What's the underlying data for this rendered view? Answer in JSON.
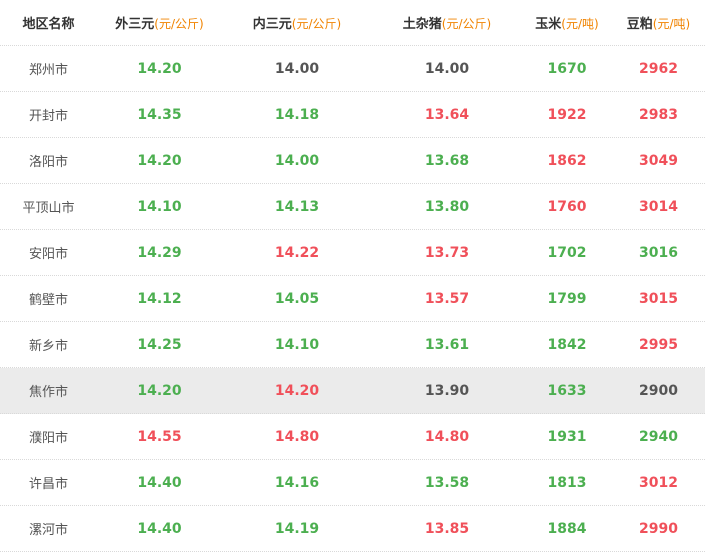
{
  "header": {
    "region": "地区名称",
    "cols": [
      {
        "name": "外三元",
        "unit": "(元/公斤)"
      },
      {
        "name": "内三元",
        "unit": "(元/公斤)"
      },
      {
        "name": "土杂猪",
        "unit": "(元/公斤)"
      },
      {
        "name": "玉米",
        "unit": "(元/吨)"
      },
      {
        "name": "豆粕",
        "unit": "(元/吨)"
      }
    ]
  },
  "colors": {
    "green": "#4caf50",
    "red": "#f0505a",
    "gray": "#555555",
    "unit_orange": "#f08300",
    "highlight_bg": "#ebebeb"
  },
  "rows": [
    {
      "region": "郑州市",
      "highlight": false,
      "values": [
        {
          "v": "14.20",
          "c": "green"
        },
        {
          "v": "14.00",
          "c": "gray"
        },
        {
          "v": "14.00",
          "c": "gray"
        },
        {
          "v": "1670",
          "c": "green"
        },
        {
          "v": "2962",
          "c": "red"
        }
      ]
    },
    {
      "region": "开封市",
      "highlight": false,
      "values": [
        {
          "v": "14.35",
          "c": "green"
        },
        {
          "v": "14.18",
          "c": "green"
        },
        {
          "v": "13.64",
          "c": "red"
        },
        {
          "v": "1922",
          "c": "red"
        },
        {
          "v": "2983",
          "c": "red"
        }
      ]
    },
    {
      "region": "洛阳市",
      "highlight": false,
      "values": [
        {
          "v": "14.20",
          "c": "green"
        },
        {
          "v": "14.00",
          "c": "green"
        },
        {
          "v": "13.68",
          "c": "green"
        },
        {
          "v": "1862",
          "c": "red"
        },
        {
          "v": "3049",
          "c": "red"
        }
      ]
    },
    {
      "region": "平顶山市",
      "highlight": false,
      "values": [
        {
          "v": "14.10",
          "c": "green"
        },
        {
          "v": "14.13",
          "c": "green"
        },
        {
          "v": "13.80",
          "c": "green"
        },
        {
          "v": "1760",
          "c": "red"
        },
        {
          "v": "3014",
          "c": "red"
        }
      ]
    },
    {
      "region": "安阳市",
      "highlight": false,
      "values": [
        {
          "v": "14.29",
          "c": "green"
        },
        {
          "v": "14.22",
          "c": "red"
        },
        {
          "v": "13.73",
          "c": "red"
        },
        {
          "v": "1702",
          "c": "green"
        },
        {
          "v": "3016",
          "c": "green"
        }
      ]
    },
    {
      "region": "鹤壁市",
      "highlight": false,
      "values": [
        {
          "v": "14.12",
          "c": "green"
        },
        {
          "v": "14.05",
          "c": "green"
        },
        {
          "v": "13.57",
          "c": "red"
        },
        {
          "v": "1799",
          "c": "green"
        },
        {
          "v": "3015",
          "c": "red"
        }
      ]
    },
    {
      "region": "新乡市",
      "highlight": false,
      "values": [
        {
          "v": "14.25",
          "c": "green"
        },
        {
          "v": "14.10",
          "c": "green"
        },
        {
          "v": "13.61",
          "c": "green"
        },
        {
          "v": "1842",
          "c": "green"
        },
        {
          "v": "2995",
          "c": "red"
        }
      ]
    },
    {
      "region": "焦作市",
      "highlight": true,
      "values": [
        {
          "v": "14.20",
          "c": "green"
        },
        {
          "v": "14.20",
          "c": "red"
        },
        {
          "v": "13.90",
          "c": "gray"
        },
        {
          "v": "1633",
          "c": "green"
        },
        {
          "v": "2900",
          "c": "gray"
        }
      ]
    },
    {
      "region": "濮阳市",
      "highlight": false,
      "values": [
        {
          "v": "14.55",
          "c": "red"
        },
        {
          "v": "14.80",
          "c": "red"
        },
        {
          "v": "14.80",
          "c": "red"
        },
        {
          "v": "1931",
          "c": "green"
        },
        {
          "v": "2940",
          "c": "green"
        }
      ]
    },
    {
      "region": "许昌市",
      "highlight": false,
      "values": [
        {
          "v": "14.40",
          "c": "green"
        },
        {
          "v": "14.16",
          "c": "green"
        },
        {
          "v": "13.58",
          "c": "green"
        },
        {
          "v": "1813",
          "c": "green"
        },
        {
          "v": "3012",
          "c": "red"
        }
      ]
    },
    {
      "region": "漯河市",
      "highlight": false,
      "values": [
        {
          "v": "14.40",
          "c": "green"
        },
        {
          "v": "14.19",
          "c": "green"
        },
        {
          "v": "13.85",
          "c": "red"
        },
        {
          "v": "1884",
          "c": "green"
        },
        {
          "v": "2990",
          "c": "red"
        }
      ]
    }
  ]
}
